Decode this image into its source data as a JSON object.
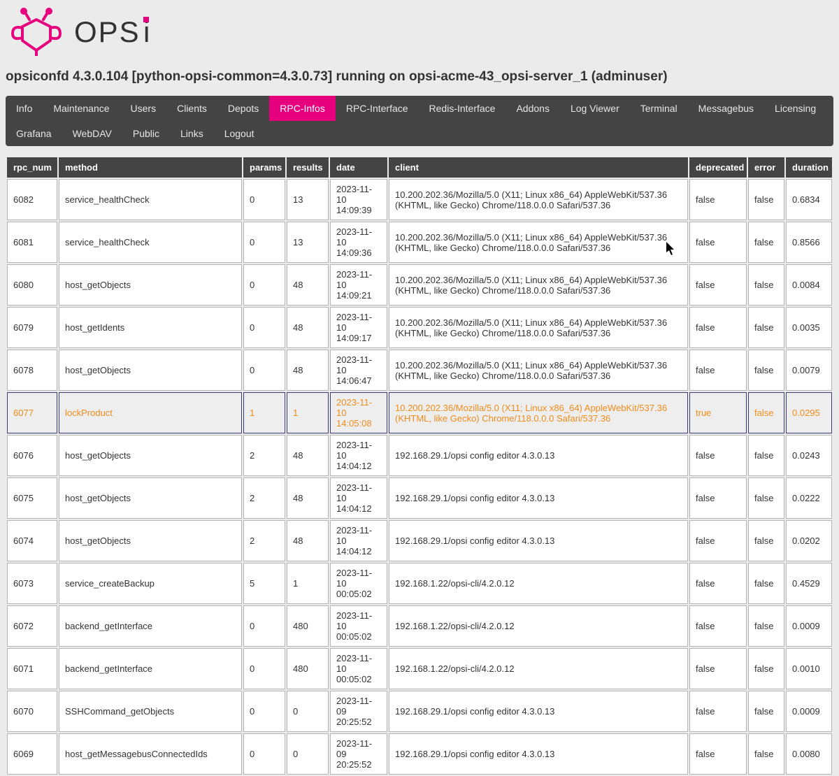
{
  "brand": {
    "name": "opsi",
    "accent": "#e6007e"
  },
  "header": {
    "title": "opsiconfd 4.3.0.104 [python-opsi-common=4.3.0.73] running on opsi-acme-43_opsi-server_1 (adminuser)"
  },
  "nav": {
    "items": [
      {
        "id": "info",
        "label": "Info",
        "active": false
      },
      {
        "id": "maintenance",
        "label": "Maintenance",
        "active": false
      },
      {
        "id": "users",
        "label": "Users",
        "active": false
      },
      {
        "id": "clients",
        "label": "Clients",
        "active": false
      },
      {
        "id": "depots",
        "label": "Depots",
        "active": false
      },
      {
        "id": "rpc-infos",
        "label": "RPC-Infos",
        "active": true
      },
      {
        "id": "rpc-interface",
        "label": "RPC-Interface",
        "active": false
      },
      {
        "id": "redis-interface",
        "label": "Redis-Interface",
        "active": false
      },
      {
        "id": "addons",
        "label": "Addons",
        "active": false
      },
      {
        "id": "log-viewer",
        "label": "Log Viewer",
        "active": false
      },
      {
        "id": "terminal",
        "label": "Terminal",
        "active": false
      },
      {
        "id": "messagebus",
        "label": "Messagebus",
        "active": false
      },
      {
        "id": "licensing",
        "label": "Licensing",
        "active": false
      },
      {
        "id": "grafana",
        "label": "Grafana",
        "active": false
      },
      {
        "id": "webdav",
        "label": "WebDAV",
        "active": false
      },
      {
        "id": "public",
        "label": "Public",
        "active": false
      },
      {
        "id": "links",
        "label": "Links",
        "active": false
      },
      {
        "id": "logout",
        "label": "Logout",
        "active": false
      }
    ]
  },
  "table": {
    "headers": {
      "rpc_num": "rpc_num",
      "method": "method",
      "params": "params",
      "results": "results",
      "date": "date",
      "client": "client",
      "deprecated": "deprecated",
      "error": "error",
      "duration": "duration"
    },
    "rows": [
      {
        "rpc_num": "6082",
        "method": "service_healthCheck",
        "params": "0",
        "results": "13",
        "date": "2023-11-10 14:09:39",
        "client": "10.200.202.36/Mozilla/5.0 (X11; Linux x86_64) AppleWebKit/537.36 (KHTML, like Gecko) Chrome/118.0.0.0 Safari/537.36",
        "deprecated": "false",
        "error": "false",
        "duration": "0.6834",
        "highlight": false
      },
      {
        "rpc_num": "6081",
        "method": "service_healthCheck",
        "params": "0",
        "results": "13",
        "date": "2023-11-10 14:09:36",
        "client": "10.200.202.36/Mozilla/5.0 (X11; Linux x86_64) AppleWebKit/537.36 (KHTML, like Gecko) Chrome/118.0.0.0 Safari/537.36",
        "deprecated": "false",
        "error": "false",
        "duration": "0.8566",
        "highlight": false
      },
      {
        "rpc_num": "6080",
        "method": "host_getObjects",
        "params": "0",
        "results": "48",
        "date": "2023-11-10 14:09:21",
        "client": "10.200.202.36/Mozilla/5.0 (X11; Linux x86_64) AppleWebKit/537.36 (KHTML, like Gecko) Chrome/118.0.0.0 Safari/537.36",
        "deprecated": "false",
        "error": "false",
        "duration": "0.0084",
        "highlight": false
      },
      {
        "rpc_num": "6079",
        "method": "host_getIdents",
        "params": "0",
        "results": "48",
        "date": "2023-11-10 14:09:17",
        "client": "10.200.202.36/Mozilla/5.0 (X11; Linux x86_64) AppleWebKit/537.36 (KHTML, like Gecko) Chrome/118.0.0.0 Safari/537.36",
        "deprecated": "false",
        "error": "false",
        "duration": "0.0035",
        "highlight": false
      },
      {
        "rpc_num": "6078",
        "method": "host_getObjects",
        "params": "0",
        "results": "48",
        "date": "2023-11-10 14:06:47",
        "client": "10.200.202.36/Mozilla/5.0 (X11; Linux x86_64) AppleWebKit/537.36 (KHTML, like Gecko) Chrome/118.0.0.0 Safari/537.36",
        "deprecated": "false",
        "error": "false",
        "duration": "0.0079",
        "highlight": false
      },
      {
        "rpc_num": "6077",
        "method": "lockProduct",
        "params": "1",
        "results": "1",
        "date": "2023-11-10 14:05:08",
        "client": "10.200.202.36/Mozilla/5.0 (X11; Linux x86_64) AppleWebKit/537.36 (KHTML, like Gecko) Chrome/118.0.0.0 Safari/537.36",
        "deprecated": "true",
        "error": "false",
        "duration": "0.0295",
        "highlight": true
      },
      {
        "rpc_num": "6076",
        "method": "host_getObjects",
        "params": "2",
        "results": "48",
        "date": "2023-11-10 14:04:12",
        "client": "192.168.29.1/opsi config editor 4.3.0.13",
        "deprecated": "false",
        "error": "false",
        "duration": "0.0243",
        "highlight": false
      },
      {
        "rpc_num": "6075",
        "method": "host_getObjects",
        "params": "2",
        "results": "48",
        "date": "2023-11-10 14:04:12",
        "client": "192.168.29.1/opsi config editor 4.3.0.13",
        "deprecated": "false",
        "error": "false",
        "duration": "0.0222",
        "highlight": false
      },
      {
        "rpc_num": "6074",
        "method": "host_getObjects",
        "params": "2",
        "results": "48",
        "date": "2023-11-10 14:04:12",
        "client": "192.168.29.1/opsi config editor 4.3.0.13",
        "deprecated": "false",
        "error": "false",
        "duration": "0.0202",
        "highlight": false
      },
      {
        "rpc_num": "6073",
        "method": "service_createBackup",
        "params": "5",
        "results": "1",
        "date": "2023-11-10 00:05:02",
        "client": "192.168.1.22/opsi-cli/4.2.0.12",
        "deprecated": "false",
        "error": "false",
        "duration": "0.4529",
        "highlight": false
      },
      {
        "rpc_num": "6072",
        "method": "backend_getInterface",
        "params": "0",
        "results": "480",
        "date": "2023-11-10 00:05:02",
        "client": "192.168.1.22/opsi-cli/4.2.0.12",
        "deprecated": "false",
        "error": "false",
        "duration": "0.0009",
        "highlight": false
      },
      {
        "rpc_num": "6071",
        "method": "backend_getInterface",
        "params": "0",
        "results": "480",
        "date": "2023-11-10 00:05:02",
        "client": "192.168.1.22/opsi-cli/4.2.0.12",
        "deprecated": "false",
        "error": "false",
        "duration": "0.0010",
        "highlight": false
      },
      {
        "rpc_num": "6070",
        "method": "SSHCommand_getObjects",
        "params": "0",
        "results": "0",
        "date": "2023-11-09 20:25:52",
        "client": "192.168.29.1/opsi config editor 4.3.0.13",
        "deprecated": "false",
        "error": "false",
        "duration": "0.0009",
        "highlight": false
      },
      {
        "rpc_num": "6069",
        "method": "host_getMessagebusConnectedIds",
        "params": "0",
        "results": "0",
        "date": "2023-11-09 20:25:52",
        "client": "192.168.29.1/opsi config editor 4.3.0.13",
        "deprecated": "false",
        "error": "false",
        "duration": "0.0080",
        "highlight": false
      }
    ]
  }
}
